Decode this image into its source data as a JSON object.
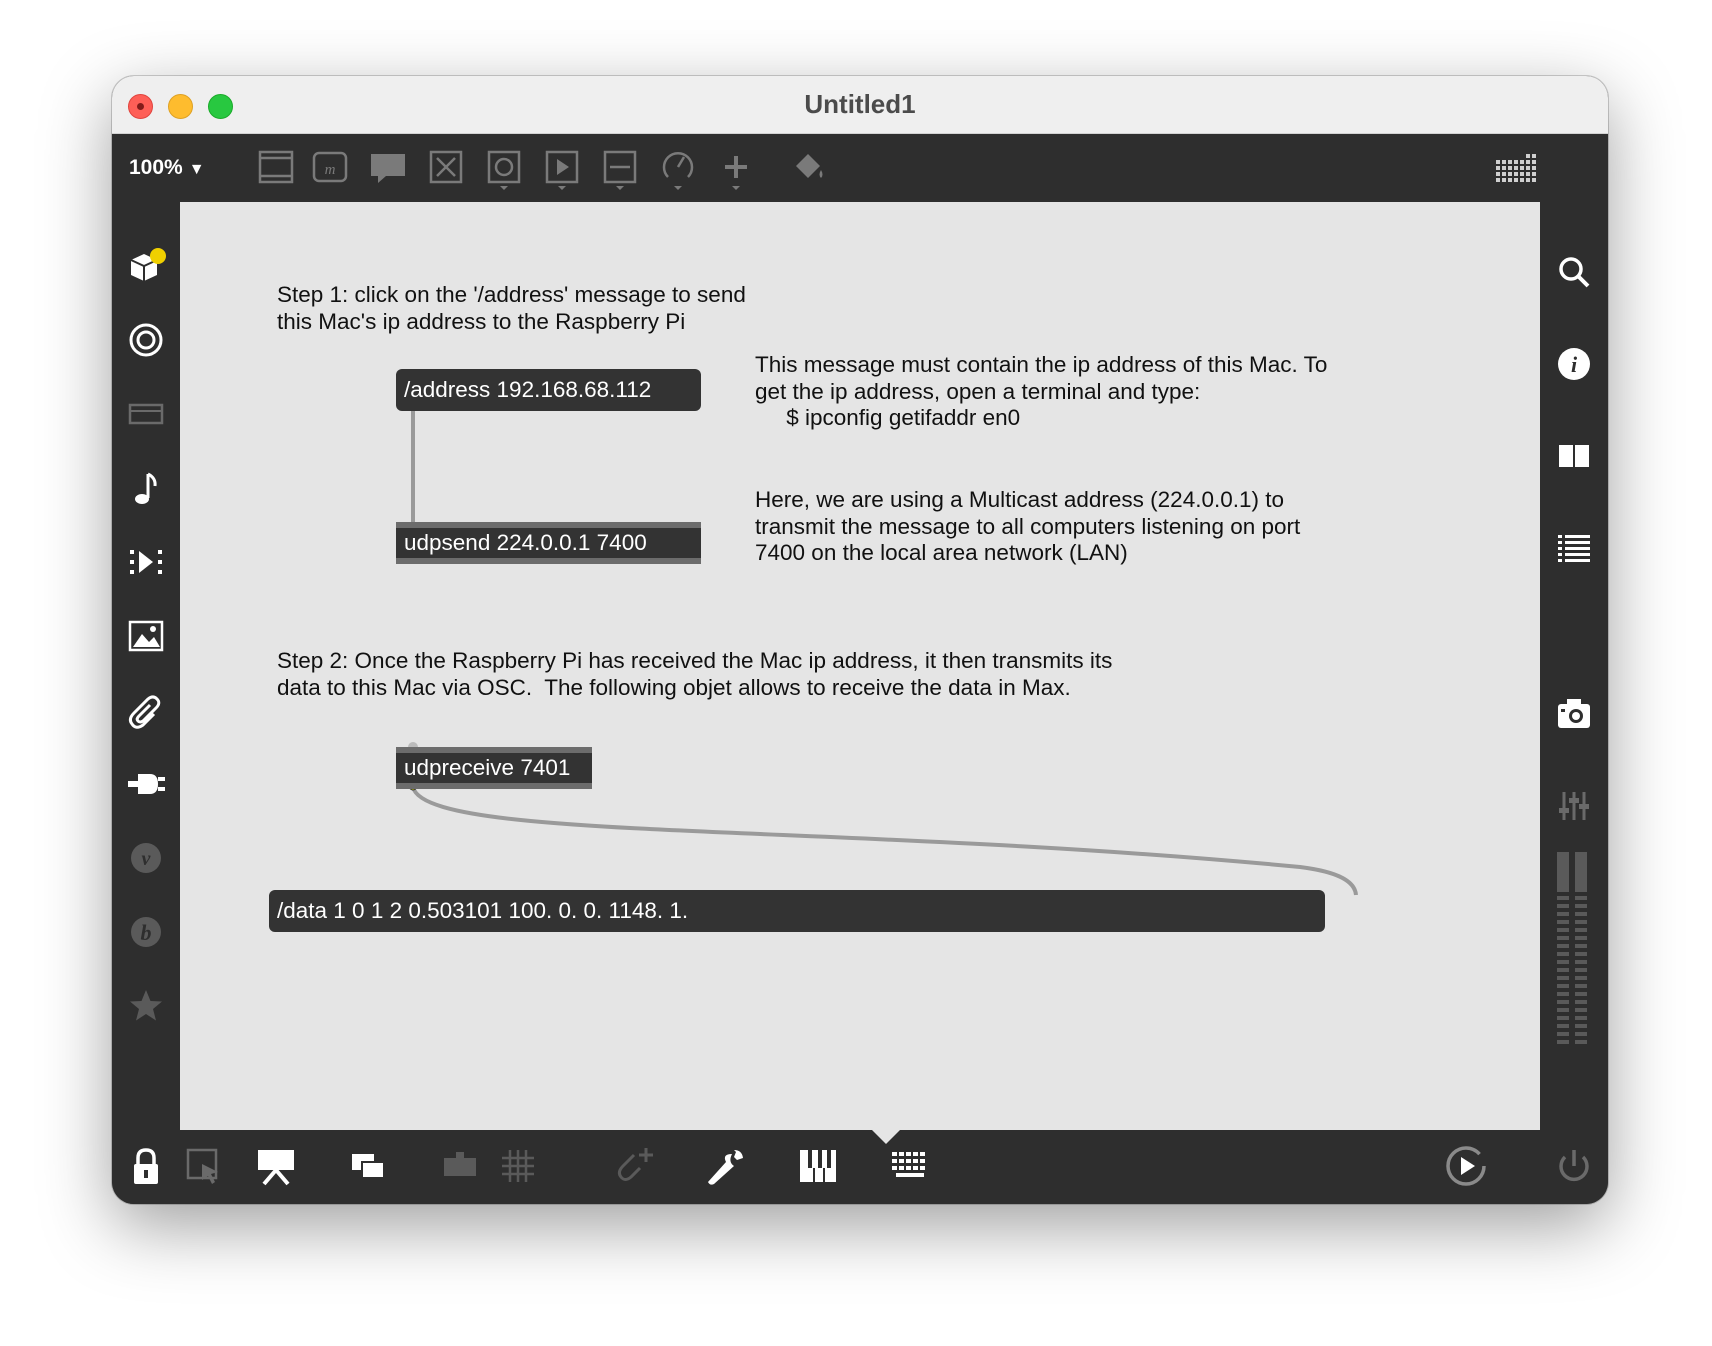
{
  "window": {
    "title": "Untitled1"
  },
  "toolbar": {
    "zoom_label": "100%",
    "zoom_caret": "▼",
    "tools": [
      "object-box-icon",
      "message-box-icon",
      "comment-icon",
      "toggle-icon",
      "bang-icon",
      "play-button-icon",
      "slider-icon",
      "dial-icon",
      "add-icon",
      "paint-bucket-icon",
      "grid-keyboard-icon"
    ]
  },
  "left_sidebar": {
    "icons": [
      "packages-icon",
      "target-icon",
      "device-icon",
      "music-note-icon",
      "media-icon",
      "image-icon",
      "paperclip-icon",
      "plug-icon",
      "vizzie-icon",
      "beap-icon",
      "star-icon"
    ]
  },
  "right_sidebar": {
    "icons": [
      "search-icon",
      "info-icon",
      "reference-icon",
      "list-icon",
      "snapshot-icon",
      "mixer-icon",
      "level-meter-icon"
    ]
  },
  "patch": {
    "step1_comment": "Step 1: click on the '/address' message to send\nthis Mac's ip address to the Raspberry Pi",
    "address_message": "/address 192.168.68.112",
    "address_comment": "This message must contain the ip address of this Mac. To\nget the ip address, open a terminal and type:\n     $ ipconfig getifaddr en0",
    "udpsend_object": "udpsend 224.0.0.1 7400",
    "multicast_comment": "Here, we are using a Multicast address (224.0.0.1) to\ntransmit the message to all computers listening on port\n7400 on the local area network (LAN)",
    "step2_comment": "Step 2: Once the Raspberry Pi has received the Mac ip address, it then transmits its\ndata to this Mac via OSC.  The following objet allows to receive the data in Max.",
    "udpreceive_object": "udpreceive 7401",
    "data_message": "/data 1 0 1 2 0.503101 100. 0. 0. 1148. 1."
  },
  "bottom_bar": {
    "icons": [
      "lock-icon",
      "select-icon",
      "presentation-icon",
      "windows-icon",
      "device-view-icon",
      "grid-icon",
      "add-clip-icon",
      "wrench-icon",
      "piano-icon",
      "keyboard-icon",
      "play-circle-icon",
      "power-icon"
    ]
  },
  "colors": {
    "chrome": "#2e2e2e",
    "canvas": "#e5e5e5",
    "box": "#333333",
    "accent_yellow": "#f0d000"
  }
}
